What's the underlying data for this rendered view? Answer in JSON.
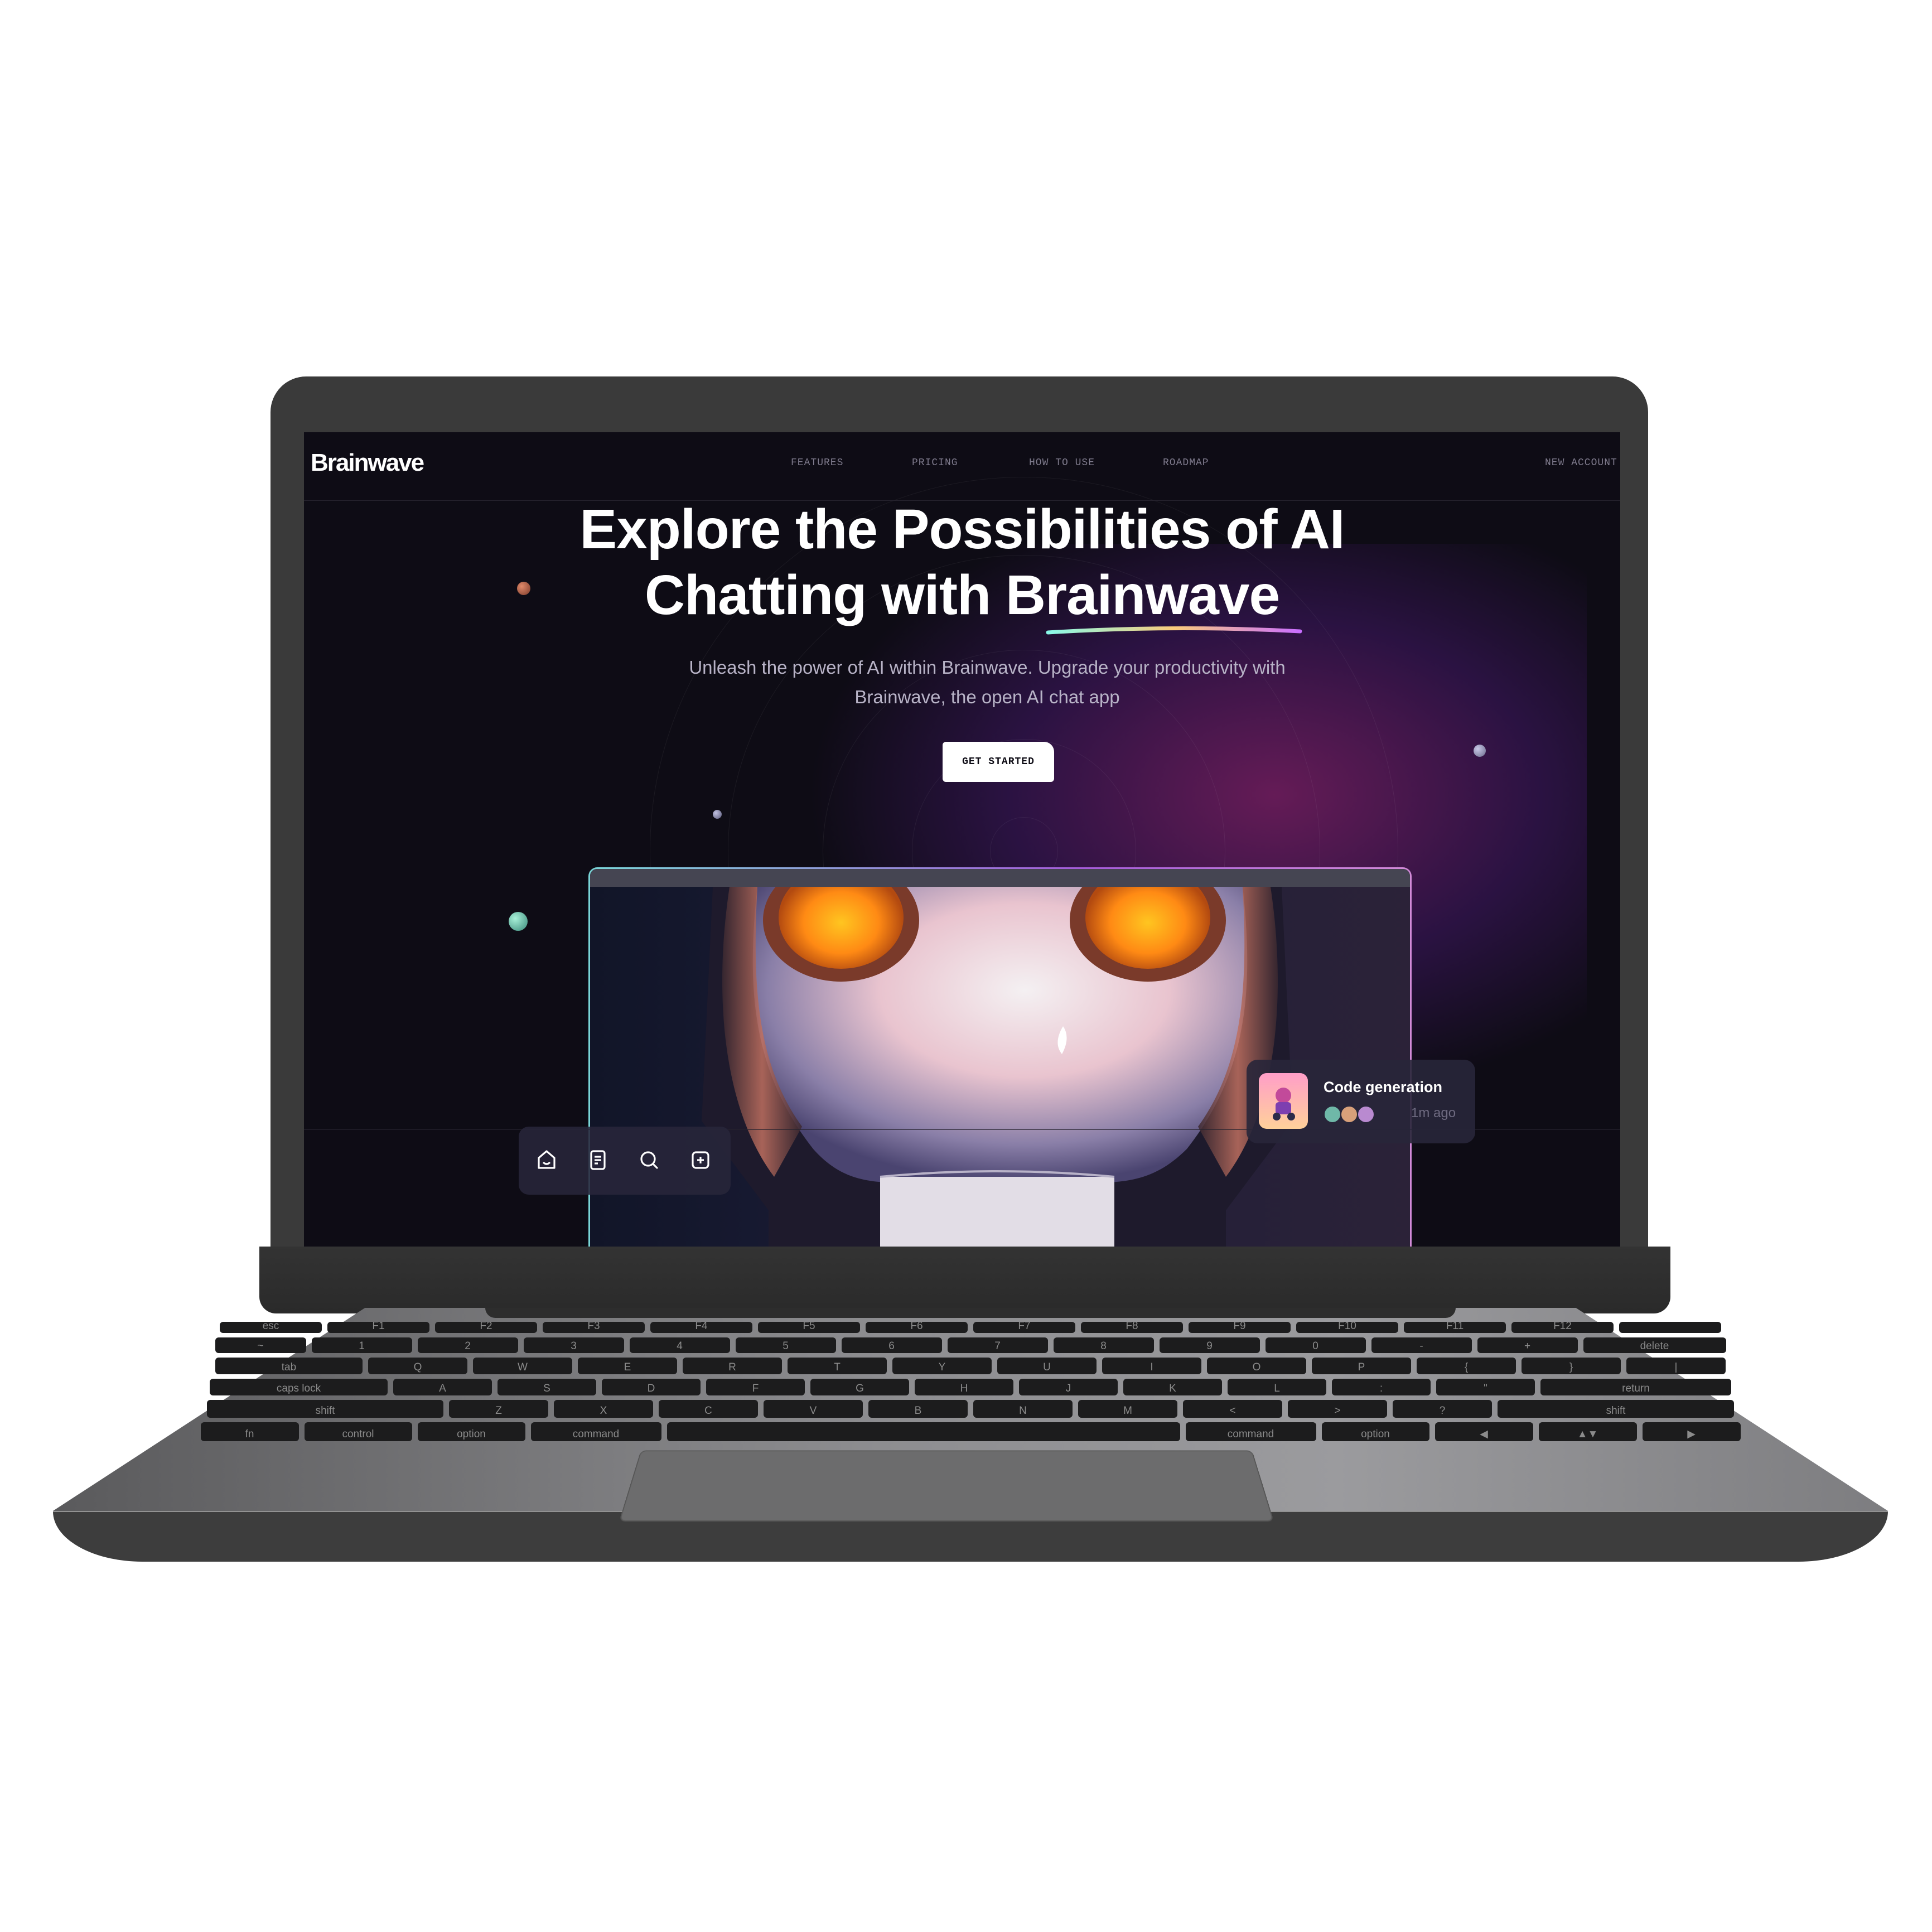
{
  "site": {
    "logo": "Brainwave",
    "nav": [
      "FEATURES",
      "PRICING",
      "HOW TO USE",
      "ROADMAP"
    ],
    "new_account": "NEW ACCOUNT",
    "headline_line1": "Explore the Possibilities of AI",
    "headline_line2_prefix": "Chatting with ",
    "headline_line2_highlight": "Brainwave",
    "subtitle_line1": "Unleash the power of AI within Brainwave. Upgrade your productivity with",
    "subtitle_line2": "Brainwave, the open AI chat app",
    "cta": "GET STARTED",
    "card_title": "Code generation",
    "card_time": "1m ago",
    "toolbar_icons": [
      "home-icon",
      "file-icon",
      "search-icon",
      "plus-square-icon"
    ]
  },
  "colors": {
    "background": "#0e0c15",
    "accent_glow": "#ac288c",
    "eye_orange": "#ff9a1a",
    "underline_gradient": [
      "#89f9e8",
      "#facb7b",
      "#c96eff"
    ]
  },
  "keyboard": {
    "fn_row": [
      "esc",
      "F1",
      "F2",
      "F3",
      "F4",
      "F5",
      "F6",
      "F7",
      "F8",
      "F9",
      "F10",
      "F11",
      "F12",
      ""
    ],
    "number_row": [
      "~",
      "1",
      "2",
      "3",
      "4",
      "5",
      "6",
      "7",
      "8",
      "9",
      "0",
      "-",
      "+",
      "delete"
    ],
    "q_row": [
      "tab",
      "Q",
      "W",
      "E",
      "R",
      "T",
      "Y",
      "U",
      "I",
      "O",
      "P",
      "{",
      "}",
      "|"
    ],
    "a_row": [
      "caps lock",
      "A",
      "S",
      "D",
      "F",
      "G",
      "H",
      "J",
      "K",
      "L",
      ":",
      "\"",
      "return"
    ],
    "z_row": [
      "shift",
      "Z",
      "X",
      "C",
      "V",
      "B",
      "N",
      "M",
      "<",
      ">",
      "?",
      "shift"
    ],
    "bottom_row": [
      "fn",
      "control",
      "option",
      "command",
      "",
      "command",
      "option",
      "◀",
      "▲▼",
      "▶"
    ]
  }
}
